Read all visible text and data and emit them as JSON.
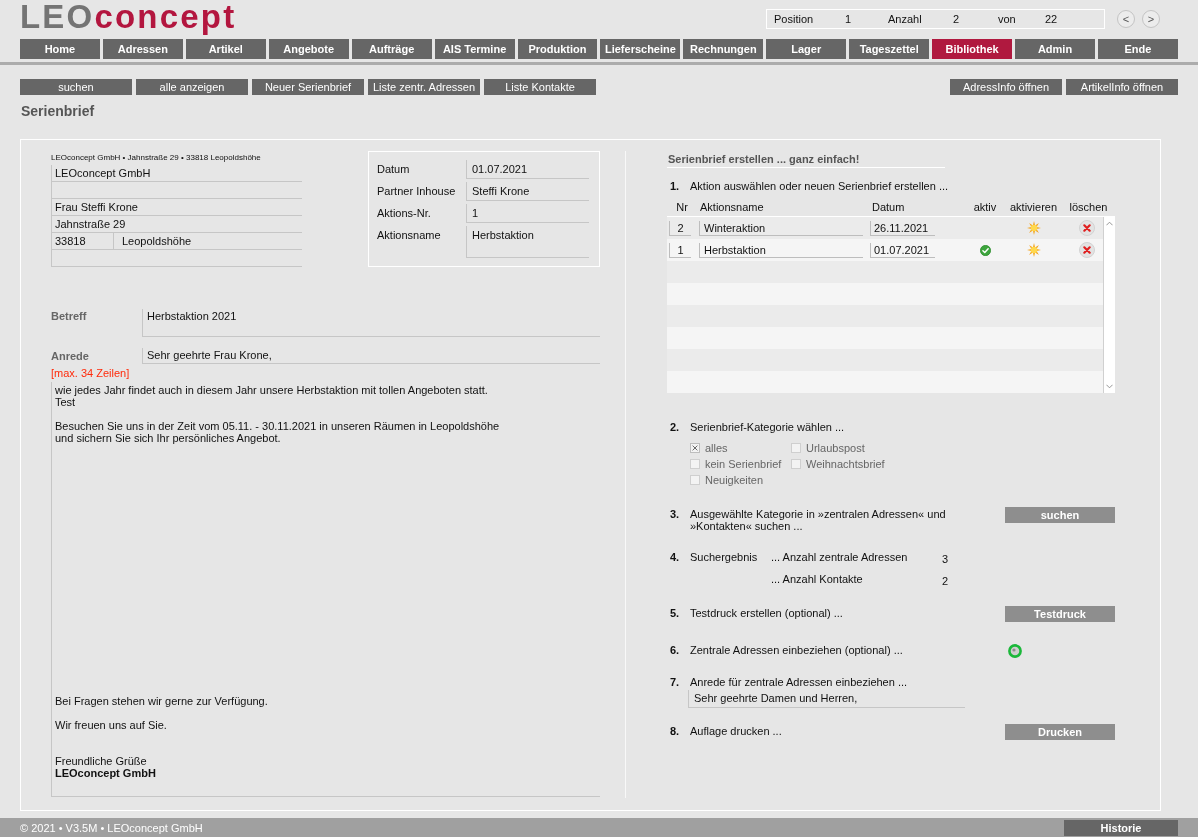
{
  "logo": {
    "prefix": "LEO",
    "suffix": "concept"
  },
  "record_info": [
    {
      "label": "Position",
      "value": "1"
    },
    {
      "label": "Anzahl",
      "value": "2"
    },
    {
      "label": "von",
      "value": "22"
    }
  ],
  "pager": [
    "<",
    ">"
  ],
  "nav_tabs": [
    {
      "label": "Home",
      "selected": false
    },
    {
      "label": "Adressen",
      "selected": false
    },
    {
      "label": "Artikel",
      "selected": false
    },
    {
      "label": "Angebote",
      "selected": false
    },
    {
      "label": "Aufträge",
      "selected": false
    },
    {
      "label": "AIS Termine",
      "selected": false
    },
    {
      "label": "Produktion",
      "selected": false
    },
    {
      "label": "Lieferscheine",
      "selected": false
    },
    {
      "label": "Rechnungen",
      "selected": false
    },
    {
      "label": "Lager",
      "selected": false
    },
    {
      "label": "Tageszettel",
      "selected": false
    },
    {
      "label": "Bibliothek",
      "selected": true
    },
    {
      "label": "Admin",
      "selected": false
    },
    {
      "label": "Ende",
      "selected": false
    }
  ],
  "toolbar": {
    "left": [
      "suchen",
      "alle anzeigen",
      "Neuer Serienbrief",
      "Liste zentr. Adressen",
      "Liste Kontakte"
    ],
    "right": [
      "AdressInfo öffnen",
      "ArtikelInfo öffnen"
    ]
  },
  "page_title": "Serienbrief",
  "letter": {
    "sender_line": "LEOconcept GmbH • Jahnstraße 29 • 33818 Leopoldshöhe",
    "address": {
      "company": "LEOconcept GmbH",
      "name": "Frau Steffi Krone",
      "street": "Jahnstraße 29",
      "zip": "33818",
      "city": "Leopoldshöhe"
    },
    "meta": [
      {
        "kind": "line",
        "label": "Datum",
        "value": "01.07.2021"
      },
      {
        "kind": "line",
        "label": "Partner Inhouse",
        "value": "Steffi Krone"
      },
      {
        "kind": "line",
        "label": "Aktions-Nr.",
        "value": "1"
      },
      {
        "kind": "area",
        "label": "Aktionsname",
        "value": "Herbstaktion"
      }
    ],
    "subject": {
      "label": "Betreff",
      "value": "Herbstaktion 2021"
    },
    "salutation": {
      "label": "Anrede",
      "value": "Sehr geehrte Frau Krone,"
    },
    "line_limit": "[max. 34 Zeilen]",
    "body": {
      "paragraphs": [
        "wie jedes Jahr findet auch in diesem Jahr unsere Herbstaktion mit tollen Angeboten statt.\nTest",
        "Besuchen Sie uns in der Zeit vom 05.11. - 30.11.2021 in unseren Räumen in Leopoldshöhe\nund sichern Sie sich Ihr persönliches Angebot."
      ],
      "closing": [
        "Bei Fragen stehen wir gerne zur Verfügung.",
        "Wir freuen uns auf Sie.",
        "Freundliche Grüße\n**LEOconcept GmbH**"
      ]
    }
  },
  "wizard": {
    "title": "Serienbrief erstellen ... ganz einfach!",
    "steps": [
      {
        "kind": "table",
        "number": "1.",
        "text": "Aktion auswählen oder neuen Serienbrief erstellen ...",
        "table": {
          "columns": [
            "Nr",
            "Aktionsname",
            "Datum",
            "aktiv",
            "aktivieren",
            "löschen"
          ],
          "rows": [
            {
              "nr": "2",
              "name": "Winteraktion",
              "date": "26.11.2021",
              "active": false
            },
            {
              "nr": "1",
              "name": "Herbstaktion",
              "date": "01.07.2021",
              "active": true
            }
          ]
        }
      },
      {
        "kind": "checkboxes",
        "number": "2.",
        "text": "Serienbrief-Kategorie wählen ...",
        "options": [
          {
            "label": "alles",
            "checked": true
          },
          {
            "label": "Urlaubspost",
            "checked": false
          },
          {
            "label": "kein Serienbrief",
            "checked": false
          },
          {
            "label": "Weihnachtsbrief",
            "checked": false
          },
          {
            "label": "Neuigkeiten",
            "checked": false
          }
        ]
      },
      {
        "kind": "button",
        "number": "3.",
        "text": "Ausgewählte Kategorie in »zentralen Adressen« und »Kontakten« suchen ...",
        "button": "suchen"
      },
      {
        "kind": "results",
        "number": "4.",
        "text": "Suchergebnis",
        "results": [
          {
            "label": "... Anzahl zentrale Adressen",
            "value": "3"
          },
          {
            "label": "... Anzahl Kontakte",
            "value": "2"
          }
        ]
      },
      {
        "kind": "button",
        "number": "5.",
        "text": "Testdruck erstellen (optional) ...",
        "button": "Testdruck"
      },
      {
        "kind": "toggle",
        "number": "6.",
        "text": "Zentrale Adressen einbeziehen (optional) ...",
        "on": true
      },
      {
        "kind": "field",
        "number": "7.",
        "text": "Anrede für zentrale Adressen einbeziehen ...",
        "value": "Sehr geehrte Damen und Herren,"
      },
      {
        "kind": "button",
        "number": "8.",
        "text": "Auflage drucken ...",
        "button": "Drucken"
      }
    ]
  },
  "footer": {
    "copyright": "© 2021 • V3.5M • LEOconcept GmbH",
    "button": "Historie"
  }
}
